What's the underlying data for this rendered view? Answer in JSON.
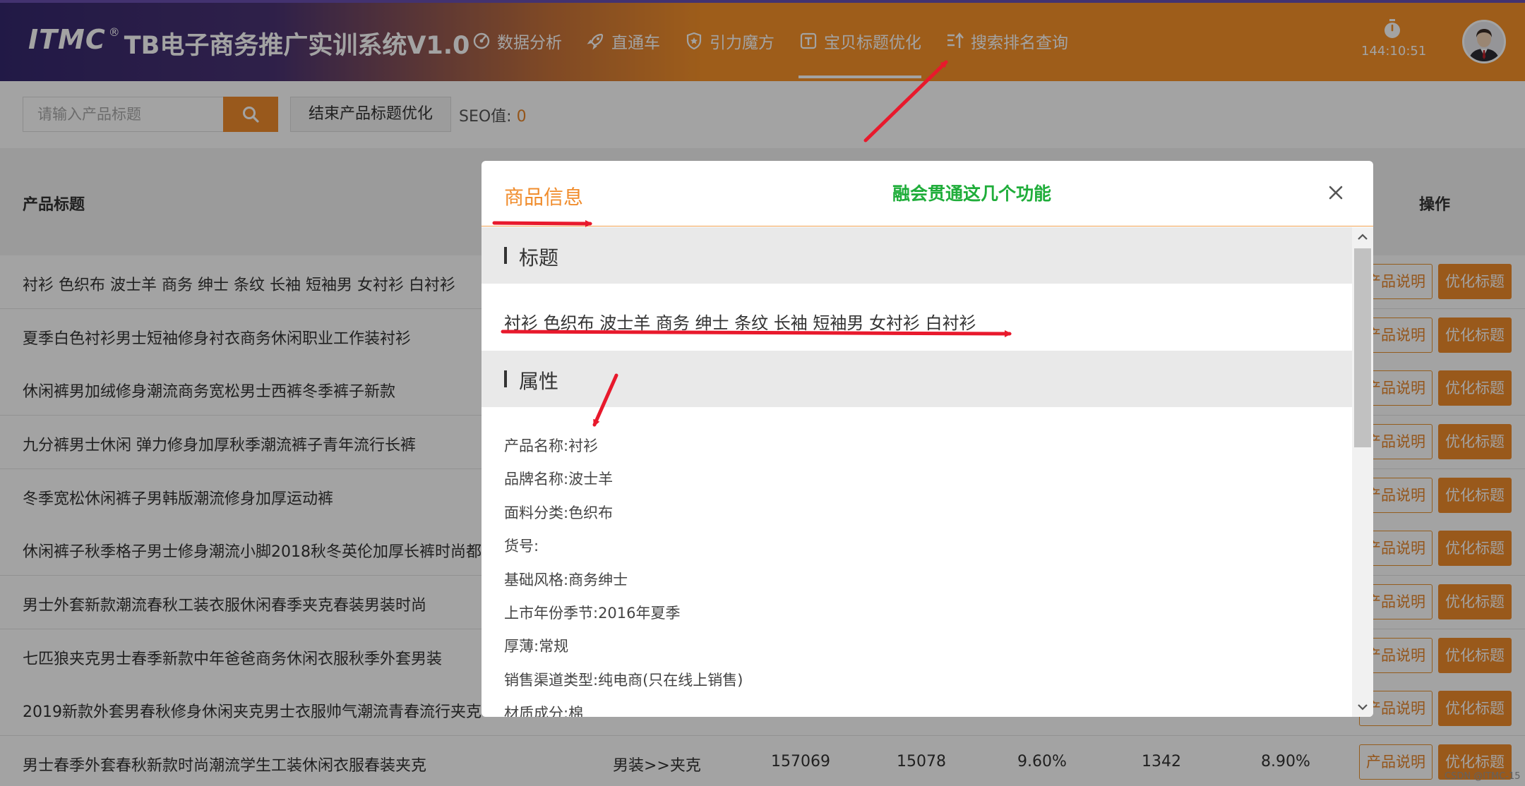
{
  "header": {
    "brand": "ITMC",
    "reg": "®",
    "title": "TB电子商务推广实训系统V1.0",
    "nav": [
      {
        "label": "数据分析",
        "icon": "chart-gauge-icon"
      },
      {
        "label": "直通车",
        "icon": "rocket-icon"
      },
      {
        "label": "引力魔方",
        "icon": "shield-icon"
      },
      {
        "label": "宝贝标题优化",
        "icon": "title-t-icon"
      },
      {
        "label": "搜索排名查询",
        "icon": "ranking-icon"
      }
    ],
    "active_index": 3,
    "timer": "144:10:51"
  },
  "toolbar": {
    "search_placeholder": "请输入产品标题",
    "end_button": "结束产品标题优化",
    "seo_label": "SEO值:",
    "seo_value": "0"
  },
  "table": {
    "col_title": "产品标题",
    "col_ops": "操作",
    "desc_button": "产品说明",
    "opt_button": "优化标题",
    "rows": [
      {
        "name": "衬衫 色织布 波士羊 商务 绅士 条纹 长袖 短袖男 女衬衫 白衬衫"
      },
      {
        "name": "夏季白色衬衫男士短袖修身衬衣商务休闲职业工作装衬衫"
      },
      {
        "name": "休闲裤男加绒修身潮流商务宽松男士西裤冬季裤子新款"
      },
      {
        "name": "九分裤男士休闲 弹力修身加厚秋季潮流裤子青年流行长裤"
      },
      {
        "name": "冬季宽松休闲裤子男韩版潮流修身加厚运动裤"
      },
      {
        "name": "休闲裤子秋季格子男士修身潮流小脚2018秋冬英伦加厚长裤时尚都"
      },
      {
        "name": "男士外套新款潮流春秋工装衣服休闲春季夹克春装男装时尚"
      },
      {
        "name": "七匹狼夹克男士春季新款中年爸爸商务休闲衣服秋季外套男装"
      },
      {
        "name": "2019新款外套男春秋修身休闲夹克男士衣服帅气潮流青春流行夹克"
      },
      {
        "name": "男士春季外套春秋新款时尚潮流学生工装休闲衣服春装夹克",
        "category": "男装>>夹克",
        "c1": "157069",
        "c2": "15078",
        "c3": "9.60%",
        "c4": "1342",
        "c5": "8.90%"
      }
    ]
  },
  "modal": {
    "title": "商品信息",
    "note": "融会贯通这几个功能",
    "section_title": "标题",
    "product_title": "衬衫 色织布 波士羊 商务 绅士 条纹 长袖 短袖男 女衬衫 白衬衫",
    "section_attrs": "属性",
    "attrs": [
      "产品名称:衬衫",
      "品牌名称:波士羊",
      "面料分类:色织布",
      "货号:",
      "基础风格:商务绅士",
      "上市年份季节:2016年夏季",
      "厚薄:常规",
      "销售渠道类型:纯电商(只在线上销售)",
      "材质成分:棉"
    ]
  },
  "watermark": "CSDN @ITMC-15",
  "colors": {
    "accent": "#f08c2c",
    "note_green": "#1fad3a",
    "arrow_red": "#e8192c"
  }
}
